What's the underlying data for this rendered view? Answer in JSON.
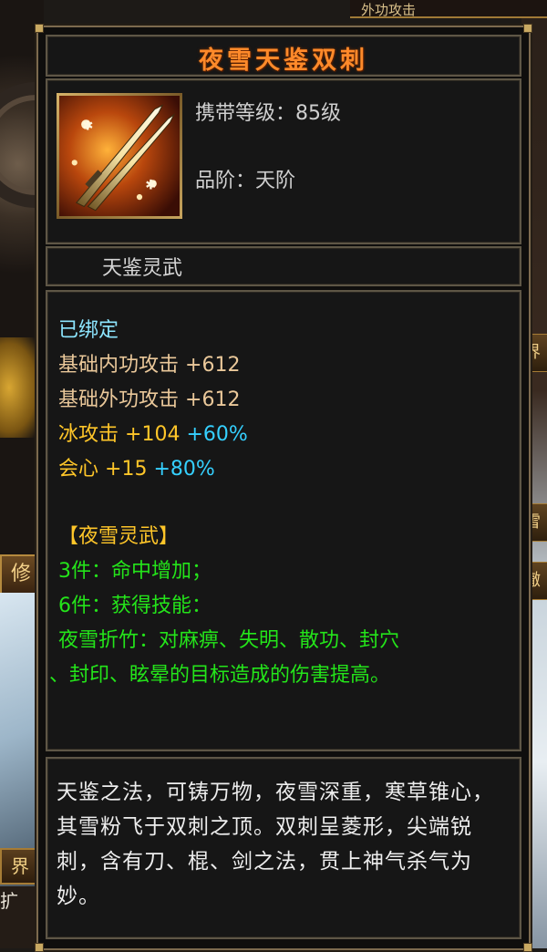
{
  "item": {
    "name": "夜雪天鉴双刺",
    "carry_level": "携带等级：85级",
    "grade": "品阶：天阶",
    "set_title": "天鉴灵武"
  },
  "attributes": {
    "bound": "已绑定",
    "base_internal_attack": {
      "label": "基础内功攻击",
      "value": "+612"
    },
    "base_external_attack": {
      "label": "基础外功攻击",
      "value": "+612"
    },
    "ice_attack": {
      "label": "冰攻击",
      "value": "+104",
      "bonus": "+60%"
    },
    "critical": {
      "label": "会心",
      "value": "+15",
      "bonus": "+80%"
    }
  },
  "set": {
    "name": "【夜雪灵武】",
    "bonus3": "3件：命中增加；",
    "bonus6": "6件：获得技能：",
    "skill_line1": "夜雪折竹：对麻痹、失明、散功、封穴",
    "skill_line2": "、封印、眩晕的目标造成的伤害提高。"
  },
  "description": "天鉴之法，可铸万物，夜雪深重，寒草锥心，其雪粉飞于双刺之顶。双刺呈菱形，尖端锐刺，含有刀、棍、剑之法，贯上神气杀气为妙。",
  "background": {
    "top_right_label": "外功攻击",
    "left_button_1": "修炼",
    "left_button_2": "界",
    "left_bottom_1": "扩",
    "right_tab_1": "界",
    "right_tab_2": "雪",
    "right_tab_3": "撤"
  },
  "colors": {
    "title": "#ff8a2a",
    "bound": "#8de6ff",
    "base_stats": "#eac89a",
    "elemental": "#ffc629",
    "percent_bonus": "#35d0ff",
    "set_text": "#24e51a",
    "description": "#ededed"
  }
}
